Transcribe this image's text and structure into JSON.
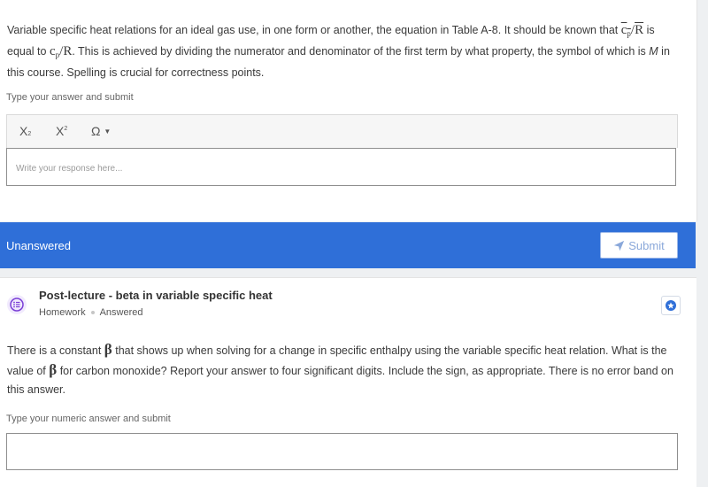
{
  "question1": {
    "text_a": "Variable specific heat relations for an ideal gas use, in one form or another, the equation in Table A-8. It should be known that ",
    "cp_symbol": "c",
    "cp_sub": "p",
    "slash1": "/",
    "rbar": "R",
    "text_b": " is equal to ",
    "cp2_symbol": "c",
    "cp2_sub": "p",
    "slash2": "/",
    "r": "R",
    "text_c": ". This is achieved by dividing the numerator and denominator of the first term by what property, the symbol of which is ",
    "m_symbol": "M",
    "text_d": " in this course. Spelling is crucial for correctness points.",
    "prompt": "Type your answer and submit",
    "toolbar": {
      "subscript": "X",
      "subscript_mark": "2",
      "superscript": "X",
      "superscript_mark": "2",
      "symbols": "Ω"
    },
    "response_placeholder": "Write your response here..."
  },
  "status_bar": {
    "status": "Unanswered",
    "submit_label": "Submit"
  },
  "question2": {
    "title": "Post-lecture - beta in variable specific heat",
    "category": "Homework",
    "state": "Answered",
    "text_a": "There is a constant ",
    "beta1": "β",
    "text_b": " that shows up when solving for a change in specific enthalpy using the variable specific heat relation. What is the value of ",
    "beta2": "β",
    "text_c": " for carbon monoxide? Report your answer to four significant digits. Include the sign, as appropriate. There is no error band on this answer.",
    "prompt": "Type your numeric answer and submit",
    "answer_value": ""
  },
  "colors": {
    "accent": "#2f6fd8",
    "homework_icon": "#7a3fd6"
  }
}
